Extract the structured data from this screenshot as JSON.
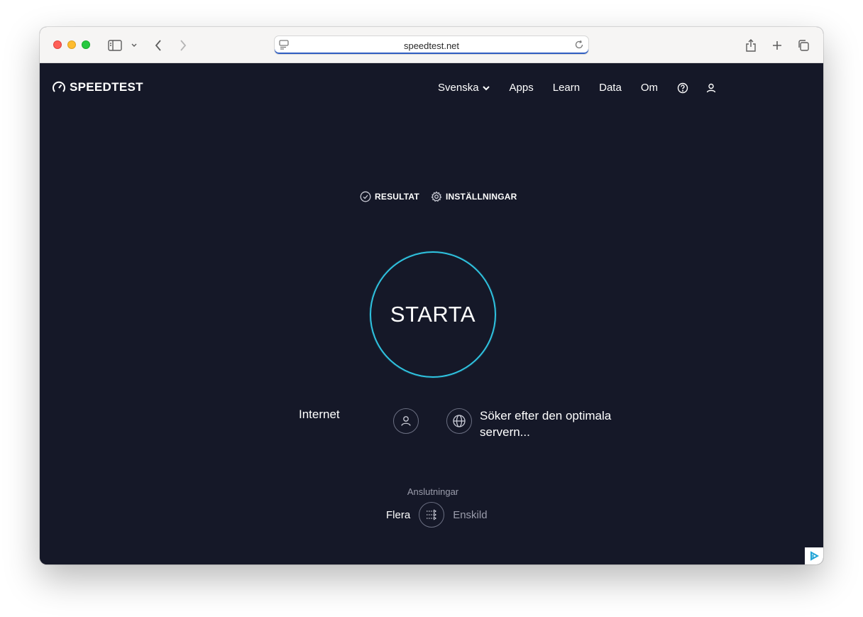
{
  "browser": {
    "url": "speedtest.net"
  },
  "header": {
    "logo_text": "SPEEDTEST",
    "nav": {
      "language": "Svenska",
      "apps": "Apps",
      "learn": "Learn",
      "data": "Data",
      "om": "Om"
    }
  },
  "tabs": {
    "results": "RESULTAT",
    "settings": "INSTÄLLNINGAR"
  },
  "start_button": "STARTA",
  "provider": {
    "isp_label": "Internet",
    "server_status": "Söker efter den optimala servern..."
  },
  "connections": {
    "label": "Anslutningar",
    "multi": "Flera",
    "single": "Enskild"
  },
  "colors": {
    "background": "#151828",
    "accent": "#2fc3e0"
  }
}
